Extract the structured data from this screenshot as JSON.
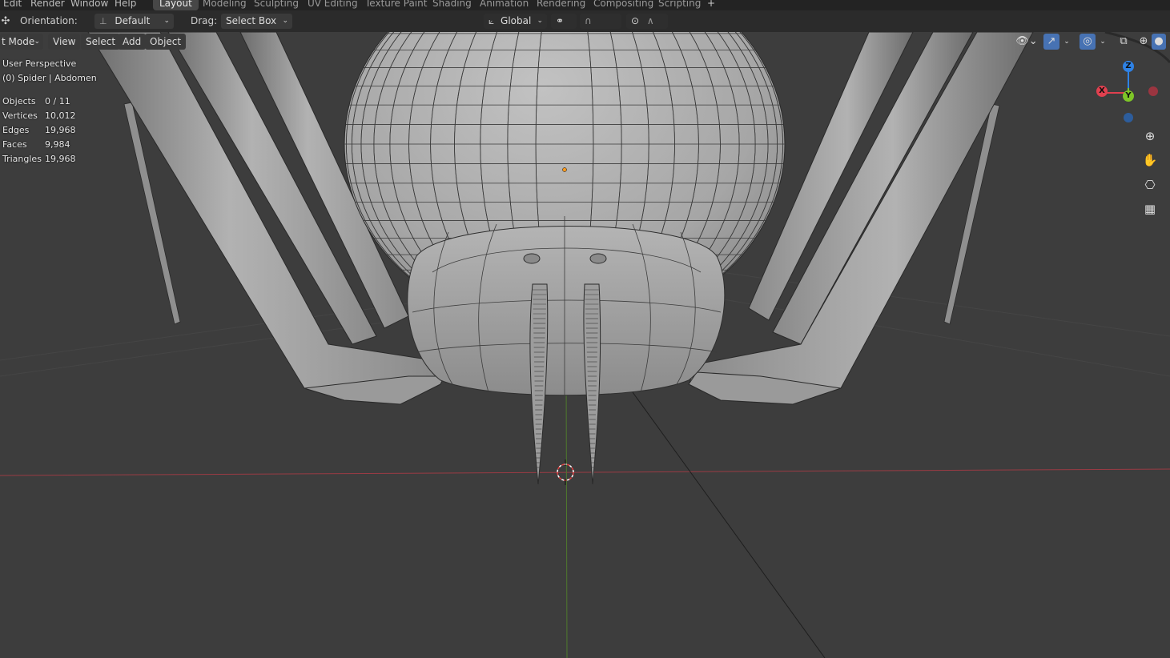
{
  "menus": [
    "Edit",
    "Render",
    "Window",
    "Help"
  ],
  "workspace_tabs": [
    "Layout",
    "Modeling",
    "Sculpting",
    "UV Editing",
    "Texture Paint",
    "Shading",
    "Animation",
    "Rendering",
    "Compositing",
    "Scripting"
  ],
  "active_tab": "Layout",
  "add_workspace_icon": "+",
  "tool_header": {
    "orientation_label": "Orientation:",
    "orientation_value": "Default",
    "drag_label": "Drag:",
    "drag_value": "Select Box",
    "transform_orientation": "Global"
  },
  "viewport_header": {
    "mode": "t Mode",
    "view": "View",
    "select": "Select",
    "add": "Add",
    "object": "Object"
  },
  "overlay": {
    "perspective": "User Perspective",
    "object_info": "(0) Spider | Abdomen",
    "stats": [
      {
        "key": "Objects",
        "value": "0 / 11"
      },
      {
        "key": "Vertices",
        "value": "10,012"
      },
      {
        "key": "Edges",
        "value": "19,968"
      },
      {
        "key": "Faces",
        "value": "9,984"
      },
      {
        "key": "Triangles",
        "value": "19,968"
      }
    ]
  },
  "gizmo": {
    "x": "X",
    "y": "Y",
    "z": "Z"
  },
  "colors": {
    "axis_x": "#e0404f",
    "axis_y": "#7ec627",
    "axis_z": "#2e82e6",
    "active_tab_bg": "#474747",
    "viewport_bg": "#3d3d3d",
    "mesh_light": "#b5b5b5",
    "mesh_dark": "#7d7d7d",
    "origin_dot": "#ff9a1f"
  },
  "icons": {
    "orientation": "transform-pivot-icon",
    "snap": "snap-magnet-icon",
    "proportional": "proportional-editing-icon",
    "zoom": "zoom-icon",
    "pan": "hand-pan-icon",
    "camera": "camera-view-icon",
    "grid": "ortho-grid-icon"
  }
}
